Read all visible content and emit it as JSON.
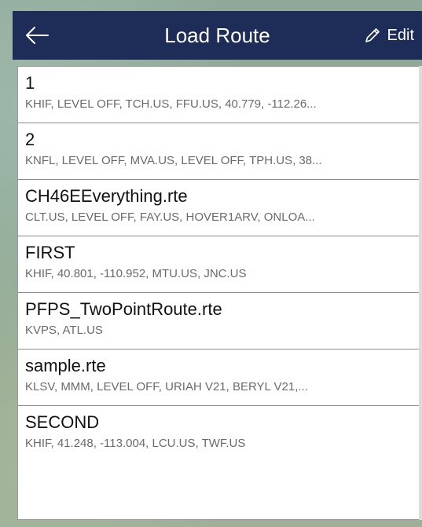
{
  "header": {
    "title": "Load Route",
    "edit_label": "Edit",
    "back_icon": "arrow-left-icon",
    "edit_icon": "pencil-icon",
    "background": "#1d2d57"
  },
  "routes": [
    {
      "name": "1",
      "detail": "KHIF, LEVEL OFF, TCH.US, FFU.US, 40.779, -112.26..."
    },
    {
      "name": "2",
      "detail": "KNFL, LEVEL OFF, MVA.US, LEVEL OFF, TPH.US, 38..."
    },
    {
      "name": "CH46EEverything.rte",
      "detail": "CLT.US, LEVEL OFF, FAY.US, HOVER1ARV, ONLOA..."
    },
    {
      "name": "FIRST",
      "detail": "KHIF, 40.801, -110.952, MTU.US, JNC.US"
    },
    {
      "name": "PFPS_TwoPointRoute.rte",
      "detail": "KVPS, ATL.US"
    },
    {
      "name": "sample.rte",
      "detail": "KLSV, MMM, LEVEL OFF, URIAH V21, BERYL V21,..."
    },
    {
      "name": "SECOND",
      "detail": "KHIF, 41.248, -113.004, LCU.US, TWF.US"
    }
  ]
}
